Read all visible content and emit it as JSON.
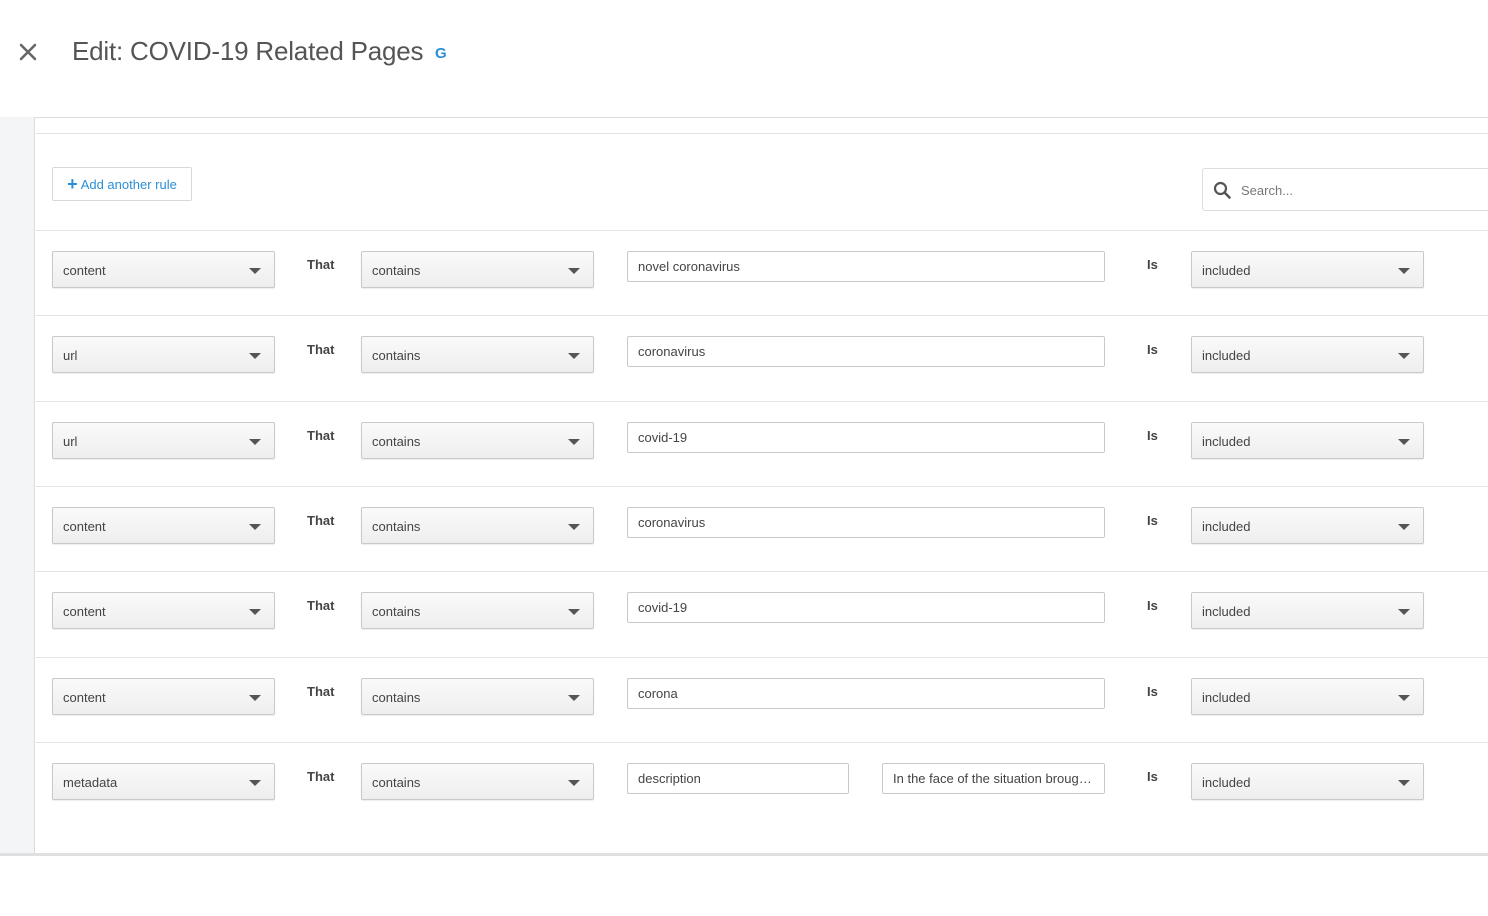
{
  "header": {
    "title": "Edit: COVID-19 Related Pages",
    "close_icon": "close-icon",
    "badge_icon": "google-icon",
    "badge_text": "G"
  },
  "toolbar": {
    "add_rule_label": "Add another rule",
    "search_placeholder": "Search..."
  },
  "labels": {
    "that": "That",
    "is": "Is"
  },
  "rules": [
    {
      "field": "content",
      "operator": "contains",
      "value": "novel coronavirus",
      "status": "included"
    },
    {
      "field": "url",
      "operator": "contains",
      "value": "coronavirus",
      "status": "included"
    },
    {
      "field": "url",
      "operator": "contains",
      "value": "covid-19",
      "status": "included"
    },
    {
      "field": "content",
      "operator": "contains",
      "value": "coronavirus",
      "status": "included"
    },
    {
      "field": "content",
      "operator": "contains",
      "value": "covid-19",
      "status": "included"
    },
    {
      "field": "content",
      "operator": "contains",
      "value": "corona",
      "status": "included"
    },
    {
      "field": "metadata",
      "operator": "contains",
      "value": "description",
      "value2": "In the face of the situation broug…",
      "status": "included"
    }
  ],
  "colors": {
    "accent": "#2a8fd8"
  }
}
